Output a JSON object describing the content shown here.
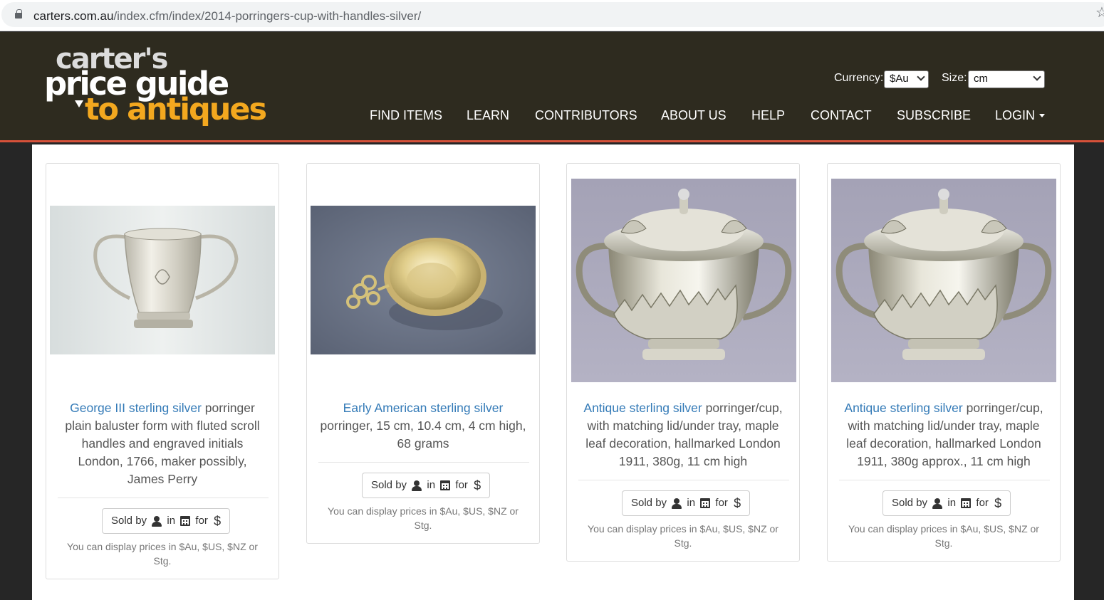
{
  "browser": {
    "url_domain": "carters.com.au",
    "url_path": "/index.cfm/index/2014-porringers-cup-with-handles-silver/"
  },
  "logo": {
    "line1": "carter's",
    "line2": "price guide",
    "line3": "to antiques"
  },
  "header": {
    "currency_label": "Currency:",
    "currency_value": "$Au",
    "size_label": "Size:",
    "size_value": "cm"
  },
  "nav": {
    "find_items": "FIND ITEMS",
    "learn": "LEARN",
    "contributors": "CONTRIBUTORS",
    "about_us": "ABOUT US",
    "help": "HELP",
    "contact": "CONTACT",
    "subscribe": "SUBSCRIBE",
    "login": "LOGIN"
  },
  "items": [
    {
      "link": "George III sterling silver",
      "text": " porringer plain baluster form with fluted scroll handles and engraved initials London, 1766, maker possibly, James Perry",
      "sold_by": "Sold by",
      "in": "in",
      "for": "for",
      "currency_symbol": "$",
      "note": "You can display prices in $Au, $US, $NZ or Stg."
    },
    {
      "link": "Early American sterling silver",
      "text": " porringer, 15 cm, 10.4 cm, 4 cm high, 68 grams",
      "sold_by": "Sold by",
      "in": "in",
      "for": "for",
      "currency_symbol": "$",
      "note": "You can display prices in $Au, $US, $NZ or Stg."
    },
    {
      "link": "Antique sterling silver",
      "text": " porringer/cup, with matching lid/under tray, maple leaf decoration, hallmarked London 1911, 380g, 11 cm high",
      "sold_by": "Sold by",
      "in": "in",
      "for": "for",
      "currency_symbol": "$",
      "note": "You can display prices in $Au, $US, $NZ or Stg."
    },
    {
      "link": "Antique sterling silver",
      "text": " porringer/cup, with matching lid/under tray, maple leaf decoration, hallmarked London 1911, 380g approx., 11 cm high",
      "sold_by": "Sold by",
      "in": "in",
      "for": "for",
      "currency_symbol": "$",
      "note": "You can display prices in $Au, $US, $NZ or Stg."
    }
  ],
  "icons": {
    "lock": "lock-icon",
    "star": "star-icon",
    "user": "user-icon",
    "calendar": "calendar-icon",
    "caret": "caret-down-icon"
  }
}
